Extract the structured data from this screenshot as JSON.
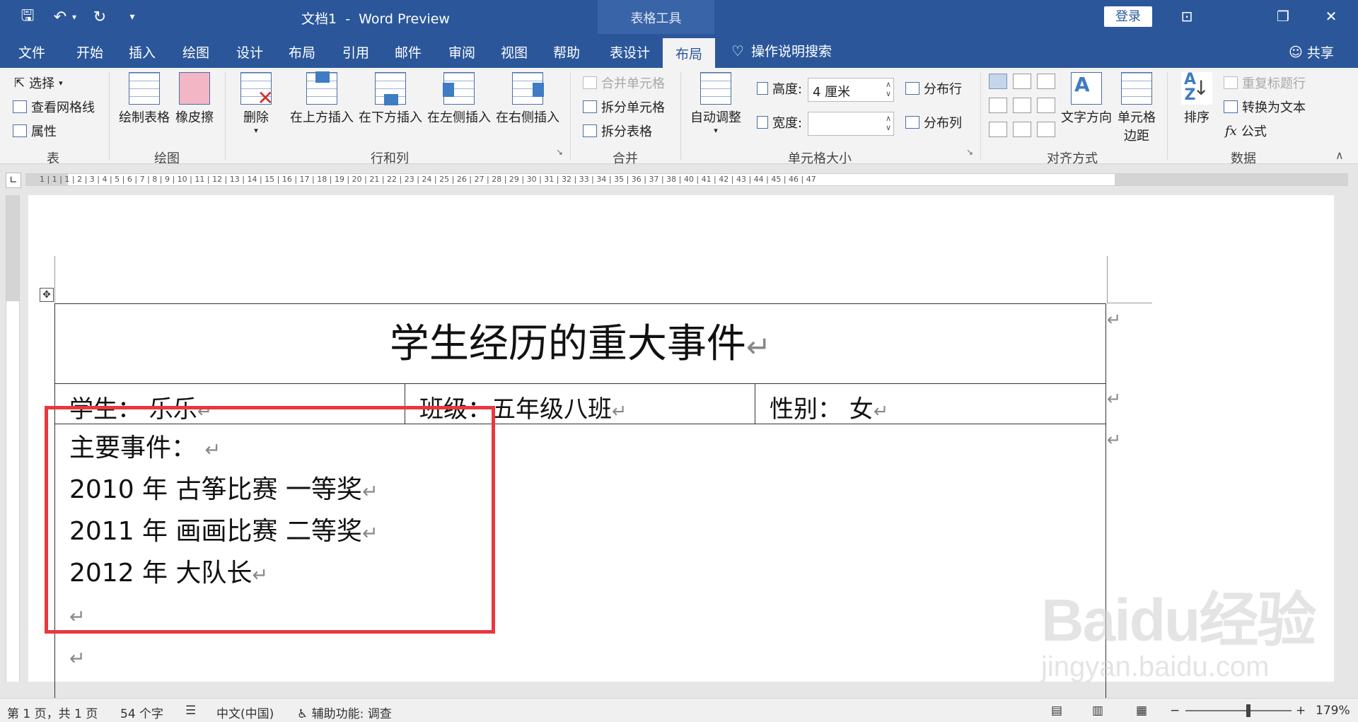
{
  "titlebar": {
    "doc_name": "文档1",
    "separator": "-",
    "app_name": "Word Preview",
    "context_tools": "表格工具",
    "login": "登录"
  },
  "tabs": [
    "文件",
    "开始",
    "插入",
    "绘图",
    "设计",
    "布局",
    "引用",
    "邮件",
    "审阅",
    "视图",
    "帮助",
    "表设计",
    "布局"
  ],
  "active_tab": "布局",
  "tellme": "操作说明搜索",
  "share": "共享",
  "ribbon": {
    "table_group": {
      "select": "选择",
      "gridlines": "查看网格线",
      "properties": "属性",
      "label": "表"
    },
    "draw_group": {
      "draw_table": "绘制表格",
      "eraser": "橡皮擦",
      "label": "绘图"
    },
    "rowcol_group": {
      "delete": "删除",
      "insert_above": "在上方插入",
      "insert_below": "在下方插入",
      "insert_left": "在左侧插入",
      "insert_right": "在右侧插入",
      "label": "行和列"
    },
    "merge_group": {
      "merge_cells": "合并单元格",
      "split_cells": "拆分单元格",
      "split_table": "拆分表格",
      "label": "合并"
    },
    "cellsize_group": {
      "autofit": "自动调整",
      "height_label": "高度:",
      "height_value": "4 厘米",
      "width_label": "宽度:",
      "width_value": "",
      "distribute_rows": "分布行",
      "distribute_cols": "分布列",
      "label": "单元格大小"
    },
    "align_group": {
      "text_direction": "文字方向",
      "cell_margins_l1": "单元格",
      "cell_margins_l2": "边距",
      "label": "对齐方式"
    },
    "data_group": {
      "sort": "排序",
      "repeat_header": "重复标题行",
      "convert_text": "转换为文本",
      "formula": "公式",
      "label": "数据"
    }
  },
  "ruler": {
    "numbers": "1 | 1 | 1 | 2 | 3 | 4 | 5 | 6 | 7 | 8 | 9 | 10 | 11 | 12 | 13 | 14 | 15 | 16 | 17 | 18 | 19 | 20 | 21 | 22 | 23 | 24 | 25 | 26 | 27 | 28 | 29 | 30 | 31 | 32 | 33 | 34 | 35 | 36 | 37 | 38 | 40 | 41 | 42 | 43 | 44 | 45 | 46 | 47"
  },
  "document": {
    "title": "学生经历的重大事件",
    "student": "学生： 乐乐",
    "class": "班级：五年级八班",
    "gender": "性别： 女",
    "events_heading": "主要事件：",
    "events": [
      "2010 年   古筝比赛  一等奖",
      "2011 年  画画比赛  二等奖",
      "2012 年  大队长"
    ],
    "para_mark": "↵"
  },
  "watermark": {
    "logo": "Baidu经验",
    "url": "jingyan.baidu.com"
  },
  "status": {
    "page": "第 1 页，共 1 页",
    "words": "54 个字",
    "language": "中文(中国)",
    "accessibility": "辅助功能: 调查",
    "zoom": "179%"
  }
}
